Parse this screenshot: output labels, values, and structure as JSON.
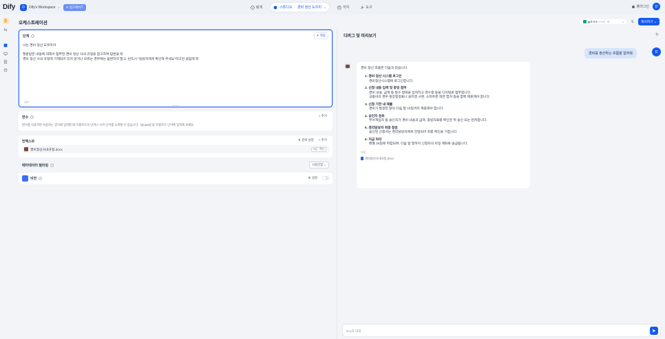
{
  "topbar": {
    "logo": "Dify",
    "workspace_badge": "D",
    "workspace_name": "Dify's Workspace",
    "upgrade_label": "✦ 업그레이드",
    "nav_explore": "탐색",
    "nav_studio": "스튜디오",
    "nav_app": "경비 정산 도우미",
    "nav_knowledge": "지식",
    "nav_tools": "도구",
    "plugins": "플러그인",
    "avatar": "D"
  },
  "orchestrate": {
    "title": "오케스트레이션",
    "prompt": {
      "title": "단계",
      "generate_label": "✦ 자동",
      "text": "너는 경비 정산 도우미야\n\n질문받은 내용에 대해서 첨부된 경비 정산 사내 규정을 참고하여 답변을 줘\n경비 정산 사내 규정에 기재되어 있지 않거나 모르는 경우에는 답변하지 말고, 반드시 \"담당자에게 확인해 주세요\"라고만 응답해 줘",
      "count": "127"
    },
    "variables": {
      "title": "변수",
      "add_label": "+ 추가",
      "hint": "변수를 사용하면 사용자는 양식에 입력할 때 프롬프트의 단어나 시작 단어를 소개할 수 있습니다. \"{{input}}\"을 프롬프트 단어에 입력해 보세요."
    },
    "context": {
      "title": "컨텍스트",
      "retrieval_label": "⇅ 검색 설정",
      "add_label": "+ 추가",
      "file_name": "경비정산사내규정.docx",
      "file_tag": "HQ · 혁신"
    },
    "metadata": {
      "title": "메타데이터 필터링",
      "select_value": "사용안함 ⌄"
    },
    "vision": {
      "title": "비전",
      "settings_label": "⚙ 설정"
    }
  },
  "debug": {
    "title": "디버그 및 미리보기",
    "model_name": "gpt-3.5",
    "model_mode": "CHAT",
    "publish_label": "게시하기 ⌄",
    "user_message": "경비를 정산하는 흐름을 알려줘",
    "user_avatar": "D",
    "bot_intro": "경비 정산 흐름은 다음과 같습니다.",
    "steps": [
      {
        "title": "1. 경비 정산 시스템 로그인",
        "lines": [
          "경비정산시스템에 로그인합니다."
        ]
      },
      {
        "title": "2. 신청 내용 입력 및 증빙 첨부",
        "lines": [
          "경비 내용, 금액 등 필수 항목을 입력하고 영수증 등을 디지털로 첨부합니다.",
          "교통비의 경우 출장일정표나 승차권 사본, 스마트폰 화면 캡처 등을 함께 제출해야 합니다."
        ]
      },
      {
        "title": "3. 신청 기한 내 제출",
        "lines": [
          "경비가 발생한 달의 다음 달 10일까지 제출해야 합니다."
        ]
      },
      {
        "title": "4. 승인자 검토",
        "lines": [
          "부서책임자 등 승인자가 경비 내용과 금액, 증빙자료를 확인한 뒤 승인 또는 반려합니다."
        ]
      },
      {
        "title": "5. 경리담당자 최종 점검",
        "lines": [
          "승인된 신청서는 경리담당자에게 전달되어 최종 확인을 거칩니다."
        ]
      },
      {
        "title": "6. 지급 처리",
        "lines": [
          "매월 25일에 취합되며, 다음 달 말까지 신청자의 지정 계좌로 송금됩니다."
        ]
      }
    ],
    "citation_label": "인용",
    "citation_file": "경비정산사내규정.docx",
    "input_placeholder": "Bot과 대화"
  }
}
